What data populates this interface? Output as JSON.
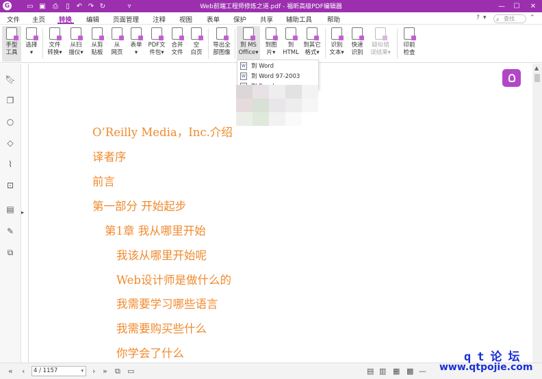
{
  "titlebar": {
    "title": "Web前端工程师修炼之道.pdf - 福昕高级PDF编辑器",
    "app_logo": "G",
    "quick_icons": [
      "folder-icon",
      "save-icon",
      "print-icon",
      "document-icon",
      "undo-icon",
      "redo-icon",
      "hand-icon",
      "customize-icon"
    ],
    "window_buttons": [
      "minimize",
      "maximize",
      "close"
    ],
    "colors": {
      "brand": "#9b2fae"
    }
  },
  "menu": {
    "items": [
      "文件",
      "主页",
      "转换",
      "编辑",
      "页面管理",
      "注释",
      "视图",
      "表单",
      "保护",
      "共享",
      "辅助工具",
      "帮助"
    ],
    "active": "转换",
    "search_placeholder": "查找"
  },
  "ribbon": {
    "buttons": [
      {
        "label": "手型\n工具",
        "icon": "hand-icon"
      },
      {
        "label": "选择\n▾",
        "icon": "select-text-icon"
      },
      {
        "label": "文件\n转换▾",
        "icon": "file-convert-icon"
      },
      {
        "label": "从扫\n描仪▾",
        "icon": "scanner-icon"
      },
      {
        "label": "从剪\n贴板",
        "icon": "clipboard-icon"
      },
      {
        "label": "从\n网页",
        "icon": "web-icon"
      },
      {
        "label": "表单\n▾",
        "icon": "form-icon"
      },
      {
        "label": "PDF文\n件包▾",
        "icon": "pdf-package-icon"
      },
      {
        "label": "合并\n文件",
        "icon": "merge-icon"
      },
      {
        "label": "空\n白页",
        "icon": "blank-page-icon"
      },
      {
        "label": "导出全\n部图像",
        "icon": "export-images-icon"
      },
      {
        "label": "到 MS\nOffice▾",
        "icon": "ms-office-icon"
      },
      {
        "label": "到图\n片▾",
        "icon": "to-image-icon"
      },
      {
        "label": "到\nHTML",
        "icon": "to-html-icon"
      },
      {
        "label": "到其它\n格式▾",
        "icon": "other-format-icon"
      },
      {
        "label": "识别\n文本▾",
        "icon": "ocr-icon"
      },
      {
        "label": "快速\n识别",
        "icon": "quick-ocr-icon"
      },
      {
        "label": "疑似错\n误结果▾",
        "icon": "suspect-results-icon"
      },
      {
        "label": "印前\n检查",
        "icon": "preflight-icon"
      }
    ]
  },
  "dropdown": {
    "items": [
      "到 Word",
      "到 Word 97-2003",
      "到 Excel"
    ]
  },
  "sidebar": {
    "icons": [
      "bookmark-icon",
      "pages-icon",
      "comments-icon",
      "layers-icon",
      "attachments-icon",
      "security-icon",
      "content-icon",
      "signature-icon",
      "compare-icon"
    ]
  },
  "document": {
    "toc": [
      "O’Reilly Media，Inc.介绍",
      "译者序",
      "前言",
      "第一部分 开始起步",
      "第1章 我从哪里开始",
      "我该从哪里开始呢",
      "Web设计师是做什么的",
      "我需要学习哪些语言",
      "我需要购买些什么",
      "你学会了什么"
    ],
    "colors": {
      "toc_text": "#f08a2e"
    }
  },
  "statusbar": {
    "page_display": "4 / 1157"
  },
  "watermark": {
    "line1": "qt论坛",
    "line2": "www.qtpojie.com"
  }
}
